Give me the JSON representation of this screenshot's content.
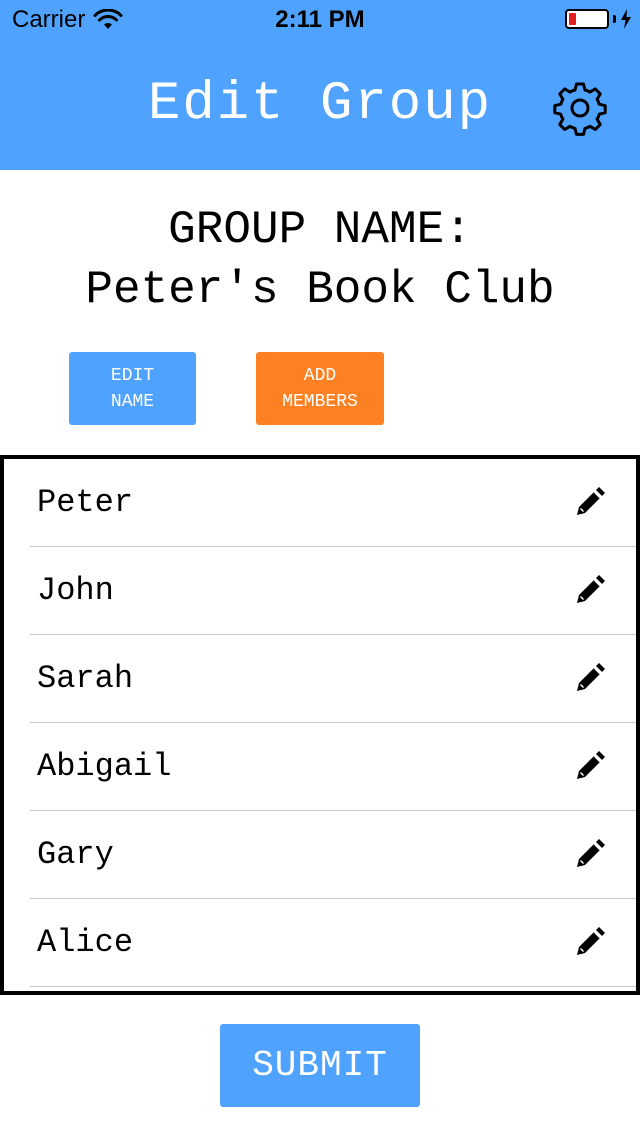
{
  "status_bar": {
    "carrier": "Carrier",
    "time": "2:11 PM",
    "battery_color": "#e02020"
  },
  "header": {
    "title": "Edit Group",
    "settings_icon": "gear-icon",
    "background": "#4fa3ff"
  },
  "group": {
    "label": "GROUP NAME:",
    "name": "Peter's Book Club"
  },
  "actions": {
    "edit_name_label": "EDIT\nNAME",
    "add_members_label": "ADD\nMEMBERS",
    "edit_color": "#4fa3ff",
    "add_color": "#fd8023"
  },
  "members": [
    {
      "name": "Peter",
      "icon": "pencil-icon"
    },
    {
      "name": "John",
      "icon": "pencil-icon"
    },
    {
      "name": "Sarah",
      "icon": "pencil-icon"
    },
    {
      "name": "Abigail",
      "icon": "pencil-icon"
    },
    {
      "name": "Gary",
      "icon": "pencil-icon"
    },
    {
      "name": "Alice",
      "icon": "pencil-icon"
    }
  ],
  "submit": {
    "label": "SUBMIT"
  }
}
